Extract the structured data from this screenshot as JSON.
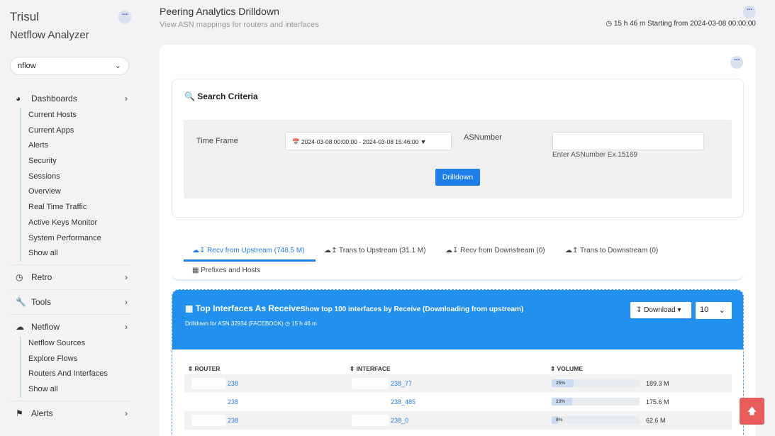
{
  "sidebar": {
    "brand": "Trisul",
    "app_name": "Netflow Analyzer",
    "context": "nflow",
    "groups": [
      {
        "icon": "dashboard-gauge-icon",
        "label": "Dashboards",
        "items": [
          "Current Hosts",
          "Current Apps",
          "Alerts",
          "Security",
          "Sessions",
          "Overview",
          "Real Time Traffic",
          "Active Keys Monitor",
          "System Performance",
          "Show all"
        ]
      },
      {
        "icon": "clock-icon",
        "label": "Retro",
        "items": []
      },
      {
        "icon": "wrench-icon",
        "label": "Tools",
        "items": []
      },
      {
        "icon": "cloud-icon",
        "label": "Netflow",
        "items": [
          "Netflow Sources",
          "Explore Flows",
          "Routers And Interfaces",
          "Show all"
        ]
      },
      {
        "icon": "bell-icon",
        "label": "Alerts",
        "items": []
      }
    ]
  },
  "header": {
    "title": "Peering Analytics Drilldown",
    "subtitle": "View ASN mappings for routers and interfaces",
    "time_info": "15 h 46 m Starting from 2024-03-08 00:00:00"
  },
  "search": {
    "title": "Search Criteria",
    "timeframe_label": "Time Frame",
    "timeframe_value": "2024-03-08 00:00:00 - 2024-03-08 15:46:00",
    "asn_label": "ASNumber",
    "asn_value": "",
    "asn_help": "Enter ASNumber Ex.15169",
    "drill_button": "Drilldown"
  },
  "tabs": [
    {
      "label": "Recv from Upstream (748.5 M)",
      "active": true
    },
    {
      "label": "Trans to Upstream (31.1 M)",
      "active": false
    },
    {
      "label": "Recv from Downstream (0)",
      "active": false
    },
    {
      "label": "Trans to Downstream (0)",
      "active": false
    },
    {
      "label": "Prefixes and Hosts",
      "active": false
    }
  ],
  "panel": {
    "title": "Top Interfaces As Receive",
    "title_suffix": "Show top 100 interfaces by Receive (Downloading from upstream)",
    "subtitle": "Drilldown for ASN 32934 (FACEBOOK)",
    "duration": "15 h 46 m",
    "download_label": "Download",
    "rows_value": "10",
    "columns": [
      "ROUTER",
      "INTERFACE",
      "VOLUME"
    ],
    "rows": [
      {
        "router": "238",
        "interface": "238_77",
        "pct_label": "25%",
        "pct": 25,
        "volume": "189.3 M"
      },
      {
        "router": "238",
        "interface": "238_485",
        "pct_label": "23%",
        "pct": 23,
        "volume": "175.6 M"
      },
      {
        "router": "238",
        "interface": "238_0",
        "pct_label": "8%",
        "pct": 8,
        "volume": "62.6 M"
      }
    ]
  },
  "colors": {
    "accent": "#1f7ee8",
    "panel": "#2190ee",
    "scroll_top": "#e85c5c"
  }
}
